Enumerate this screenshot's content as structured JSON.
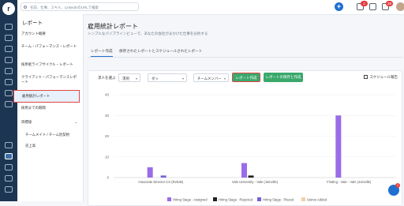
{
  "topbar": {
    "search_placeholder": "名前、仕事、スキル、LinkedInのURLで検索",
    "badges": {
      "notifications": "2",
      "messages": "",
      "inbox": "28"
    }
  },
  "sidebar": {
    "title": "レポート",
    "items": [
      {
        "label": "アカウント概要"
      },
      {
        "label": "チーム・パフォーマンス・レポート"
      },
      {
        "label": "採用者ライフサイクル・レポート"
      },
      {
        "label": "クライアント・パフォーマンスレポート"
      },
      {
        "label": "雇用統計レポート"
      },
      {
        "label": "採用までの期間"
      },
      {
        "label": "目標値"
      },
      {
        "label": "チームメイト / チーム別契約"
      },
      {
        "label": "売上高"
      }
    ]
  },
  "main": {
    "title": "雇用統計レポート",
    "subtitle": "シンプルなパイプラインビューで、あなたの会社がまかけた仕事を分析する",
    "tabs": [
      {
        "label": "レポート作成"
      },
      {
        "label": "保存されたレポートとスケジュールされたレポート"
      }
    ]
  },
  "filters": {
    "label": "求人を選ぶ",
    "select1": "求刑",
    "select2": "ダッ",
    "select3": "チームメンバー",
    "create_button": "レポート作成",
    "save_button": "レポートの保存と作成",
    "schedule_button": "スケジュール報告"
  },
  "colors": {
    "accent": "#1f6fd1",
    "green": "#3aa86b",
    "highlight": "#e04545",
    "rail": "#1c3552"
  },
  "chat": {
    "badge": "1"
  },
  "chart_data": {
    "type": "bar",
    "categories": [
      "Associate Director CS (Rehab)",
      "Vale University - Vale (Joinville)",
      "Finding - Vale - Vale (Joinville)"
    ],
    "series": [
      {
        "name": "Hiring Stage : Assigned",
        "color": "#9b6ce8",
        "values": [
          5,
          7,
          30
        ]
      },
      {
        "name": "Hiring Stage : Rejected",
        "color": "#222222",
        "values": [
          0,
          1,
          0
        ]
      },
      {
        "name": "Hiring Stage : Placed",
        "color": "#7b5fd6",
        "values": [
          1,
          0,
          0
        ]
      },
      {
        "name": "Stores Added",
        "color": "#f0d1a8",
        "values": [
          0,
          0,
          0
        ]
      }
    ],
    "yticks": [
      0,
      10,
      20,
      30,
      40
    ],
    "ylim": [
      0,
      40
    ]
  }
}
